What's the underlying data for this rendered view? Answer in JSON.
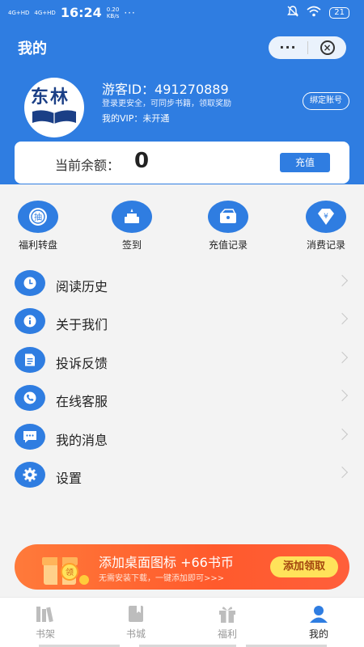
{
  "status": {
    "signal_1": "4G+HD",
    "signal_2": "4G+HD",
    "time": "16:24",
    "speed": "0.20",
    "speed_unit": "KB/s",
    "dots": "···",
    "battery": "21"
  },
  "header": {
    "title": "我的",
    "more": "···"
  },
  "profile": {
    "avatar_text": "东林",
    "uid": "游客ID：491270889",
    "tip": "登录更安全，可同步书籍，领取奖励",
    "vip": "我的VIP：未开通",
    "bind": "绑定账号"
  },
  "balance": {
    "label": "当前余额：",
    "amount": "0",
    "recharge": "充值"
  },
  "quick": [
    {
      "label": "福利转盘",
      "icon": "lottery-icon"
    },
    {
      "label": "签到",
      "icon": "checkin-cake-icon"
    },
    {
      "label": "充值记录",
      "icon": "wallet-icon"
    },
    {
      "label": "消费记录",
      "icon": "yen-diamond-icon"
    }
  ],
  "menu": [
    {
      "label": "阅读历史",
      "icon": "clock-icon"
    },
    {
      "label": "关于我们",
      "icon": "info-icon"
    },
    {
      "label": "投诉反馈",
      "icon": "document-icon"
    },
    {
      "label": "在线客服",
      "icon": "phone-icon"
    },
    {
      "label": "我的消息",
      "icon": "chat-icon"
    },
    {
      "label": "设置",
      "icon": "gear-icon"
    }
  ],
  "banner": {
    "title": "添加桌面图标 +66书币",
    "subtitle": "无需安装下载，一键添加即可>>>",
    "button": "添加领取",
    "gift_text": "领"
  },
  "tabs": [
    {
      "label": "书架",
      "active": false
    },
    {
      "label": "书城",
      "active": false
    },
    {
      "label": "福利",
      "active": false
    },
    {
      "label": "我的",
      "active": true
    }
  ],
  "colors": {
    "primary": "#2f7de1",
    "banner": "#ff5a2c",
    "banner_button": "#ffe25a"
  }
}
